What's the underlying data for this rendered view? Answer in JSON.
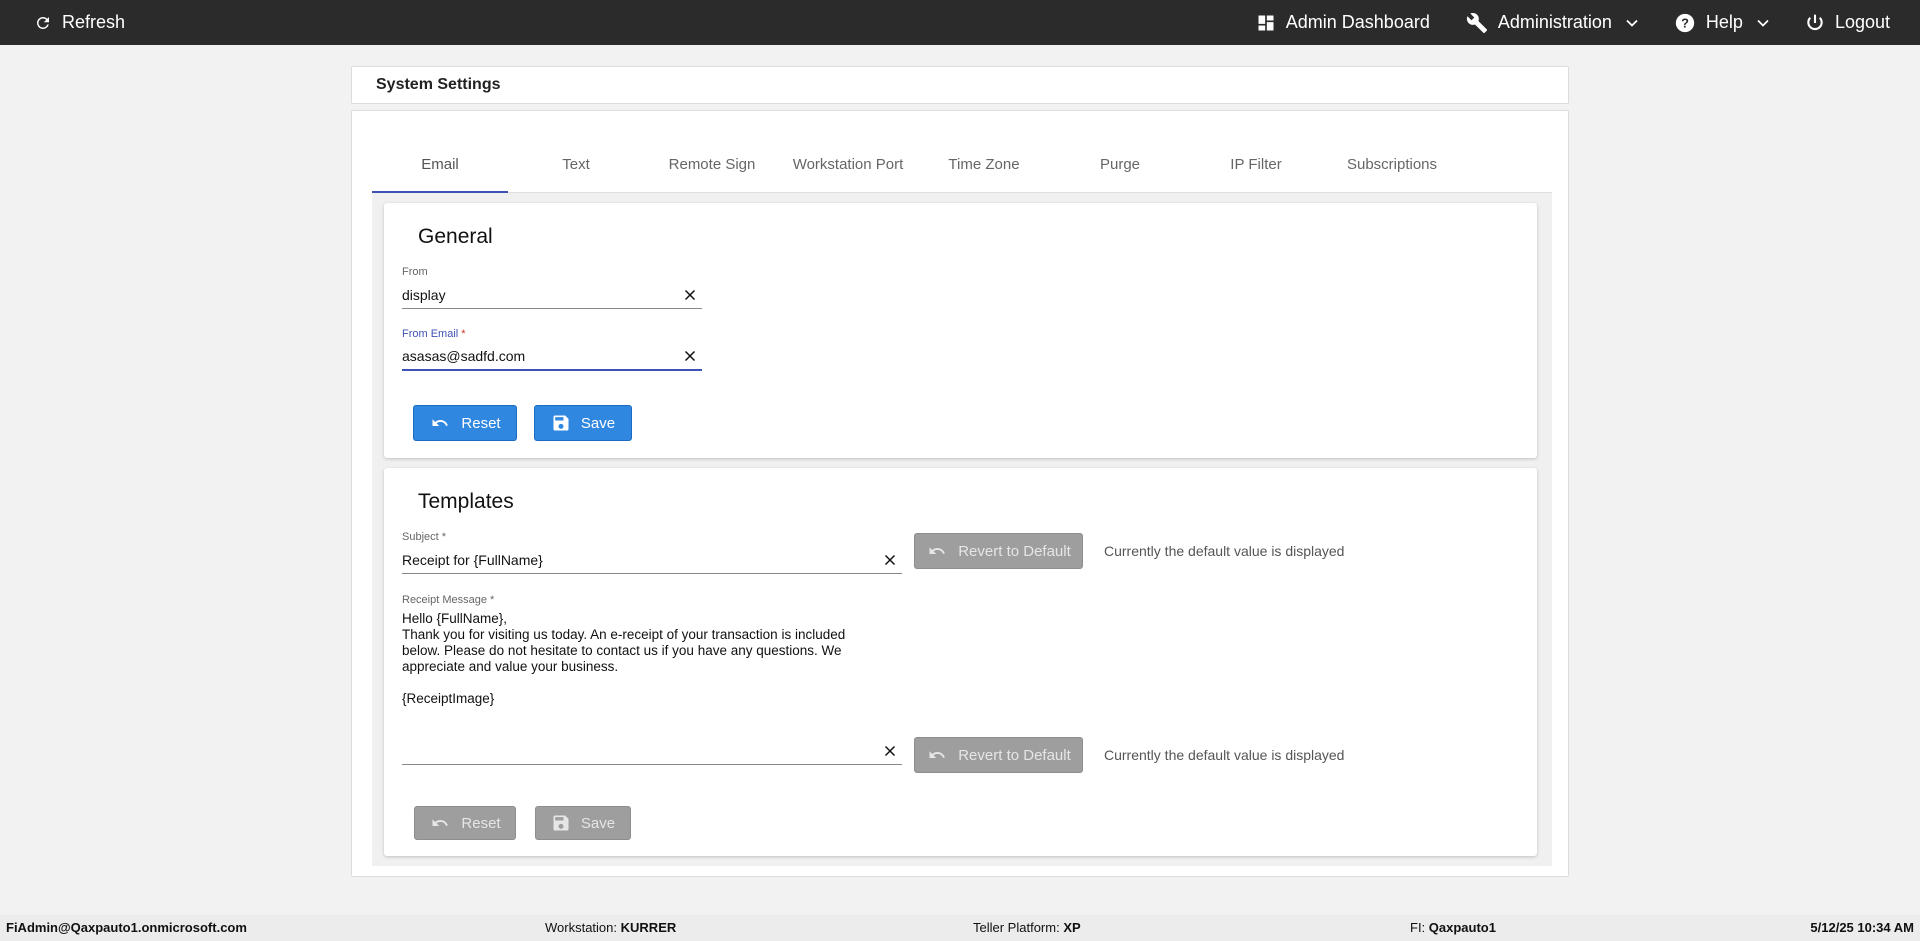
{
  "topbar": {
    "refresh": "Refresh",
    "admin_dashboard": "Admin Dashboard",
    "administration": "Administration",
    "help": "Help",
    "logout": "Logout"
  },
  "page_title": "System Settings",
  "tabs": [
    "Email",
    "Text",
    "Remote Sign",
    "Workstation Port",
    "Time Zone",
    "Purge",
    "IP Filter",
    "Subscriptions"
  ],
  "active_tab": "Email",
  "general": {
    "title": "General",
    "from_label": "From",
    "from_value": "display",
    "from_email_label": "From Email",
    "from_email_value": "asasas@sadfd.com",
    "required_mark": "*",
    "reset_label": "Reset",
    "save_label": "Save"
  },
  "templates": {
    "title": "Templates",
    "subject_label": "Subject *",
    "subject_value": "Receipt for {FullName}",
    "revert_label": "Revert to Default",
    "default_hint": "Currently the default value is displayed",
    "message_label": "Receipt Message *",
    "message_value": "Hello {FullName},\nThank you for visiting us today. An e-receipt of your transaction is included\nbelow. Please do not hesitate to contact us if you have any questions. We\nappreciate and value your business.\n\n{ReceiptImage}",
    "message2_value": "",
    "reset_label": "Reset",
    "save_label": "Save"
  },
  "footer": {
    "user": "FiAdmin@Qaxpauto1.onmicrosoft.com",
    "workstation_label": "Workstation:",
    "workstation_value": "KURRER",
    "platform_label": "Teller Platform:",
    "platform_value": "XP",
    "fi_label": "FI:",
    "fi_value": "Qaxpauto1",
    "datetime": "5/12/25 10:34 AM"
  },
  "colors": {
    "topbar": "#2b2b2b",
    "accent": "#3f51b5",
    "primary_button": "#2f87e0",
    "disabled_button": "#9e9e9e"
  }
}
